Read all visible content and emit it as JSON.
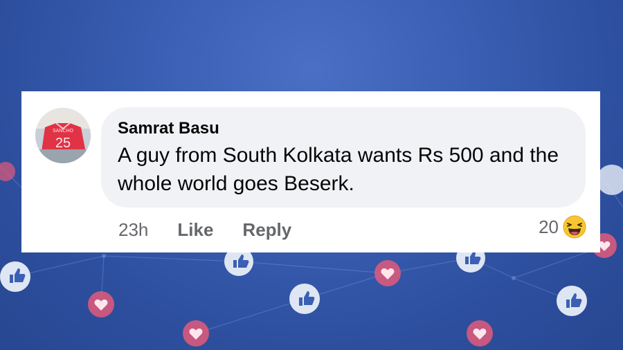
{
  "comment": {
    "author": "Samrat Basu",
    "text": "A guy from South Kolkata wants Rs 500 and the whole world goes Beserk.",
    "avatar_jersey_name": "SANCHO",
    "avatar_jersey_number": "25",
    "time": "23h",
    "like_label": "Like",
    "reply_label": "Reply",
    "reaction_count": "20",
    "reaction_icon": "laughing-emoji-icon"
  },
  "colors": {
    "background": "#3a5fb4",
    "card": "#ffffff",
    "bubble": "#f0f2f5",
    "meta_text": "#65676b",
    "like_icon_bg": "#dfe6f3",
    "heart_icon_bg": "#e35a7a"
  }
}
